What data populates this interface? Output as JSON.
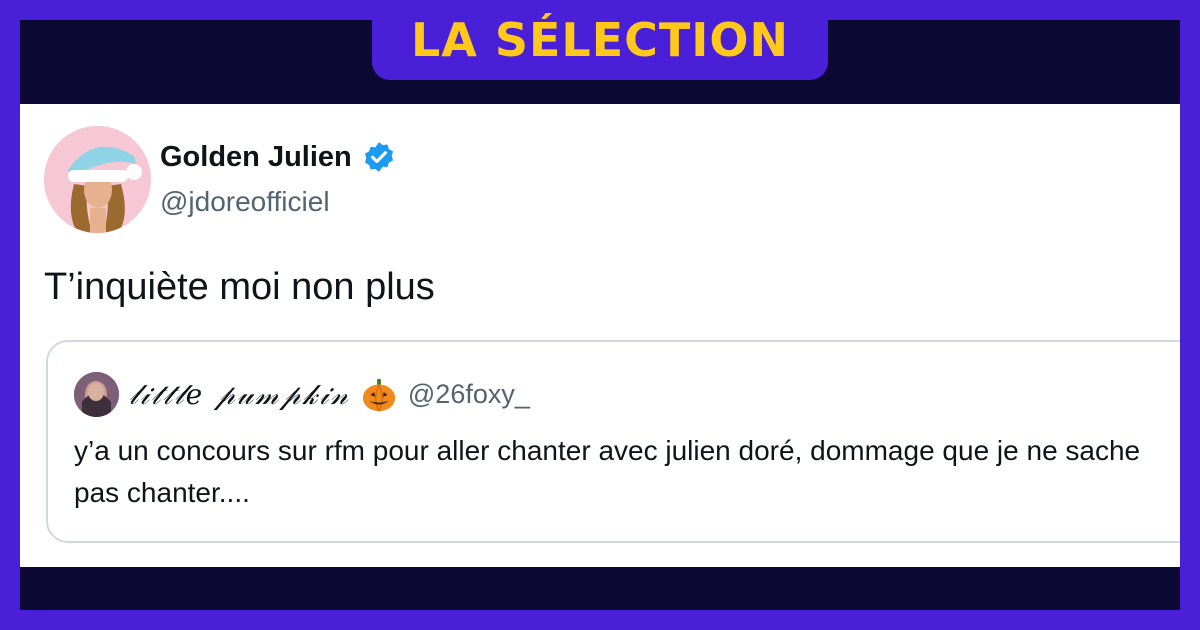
{
  "banner": {
    "title": "LA SÉLECTION"
  },
  "tweet": {
    "author_name": "Golden Julien",
    "author_handle": "@jdoreofficiel",
    "text": "T’inquiète moi non plus"
  },
  "quoted_tweet": {
    "author_name": "𝓁𝒾𝓉𝓉𝓁𝑒 𝓅𝓊𝓂𝓅𝓀𝒾𝓃",
    "author_handle": "@26foxy_",
    "text": "y’a un concours sur rfm pour aller chanter avec julien doré, dommage que je ne sache pas chanter...."
  },
  "colors": {
    "frame": "#4a1fd8",
    "dark_band": "#0b0833",
    "banner_text": "#ffc81a",
    "verified": "#1d9bf0"
  }
}
